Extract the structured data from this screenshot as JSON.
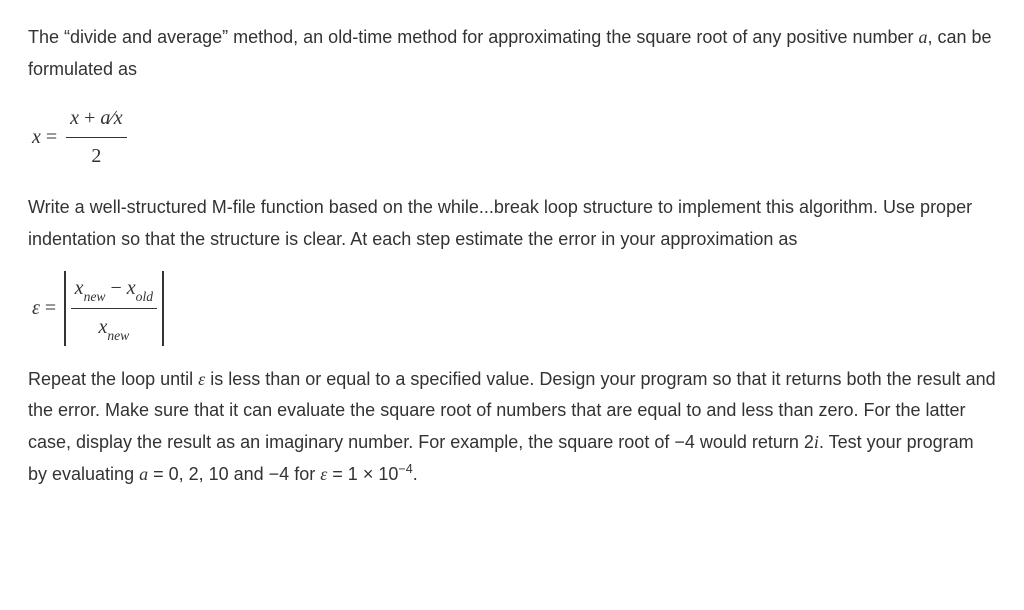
{
  "para1_part1": "The “divide and average” method, an old-time method for approximating the square root of any positive number ",
  "para1_var": "a",
  "para1_part2": ", can be formulated as",
  "eq1": {
    "lhs_var": "x",
    "equals": " = ",
    "num_part1": "x",
    "num_plus": " + ",
    "num_var_a": "a",
    "num_slash": "∕",
    "num_var_x": "x",
    "den": "2"
  },
  "para2": "Write a well-structured M-file function based on the while...break loop structure to implement this algorithm. Use proper indentation so that the structure is clear. At each step estimate the error in your approximation as",
  "eq2": {
    "lhs_eps": "ε",
    "equals": " = ",
    "num_x1": "x",
    "num_sub1": "new",
    "num_minus": " − ",
    "num_x2": "x",
    "num_sub2": "old",
    "den_x": "x",
    "den_sub": "new"
  },
  "para3_part1": "Repeat the loop until ",
  "para3_eps": "ε",
  "para3_part2": " is less than or equal to a specified value. Design your program so that it returns both the result and the error. Make sure that it can evaluate the square root of numbers that are equal to and less than zero. For the latter case, display the result as an imaginary number. For example, the square root of −4 would return 2",
  "para3_i": "i",
  "para3_part3": ". Test your program by evaluating ",
  "para3_a": "a",
  "para3_part4": " = 0, 2, 10 and −4 for ",
  "para3_eps2": "ε",
  "para3_part5": " = 1 × 10",
  "para3_exp": "−4",
  "para3_part6": "."
}
